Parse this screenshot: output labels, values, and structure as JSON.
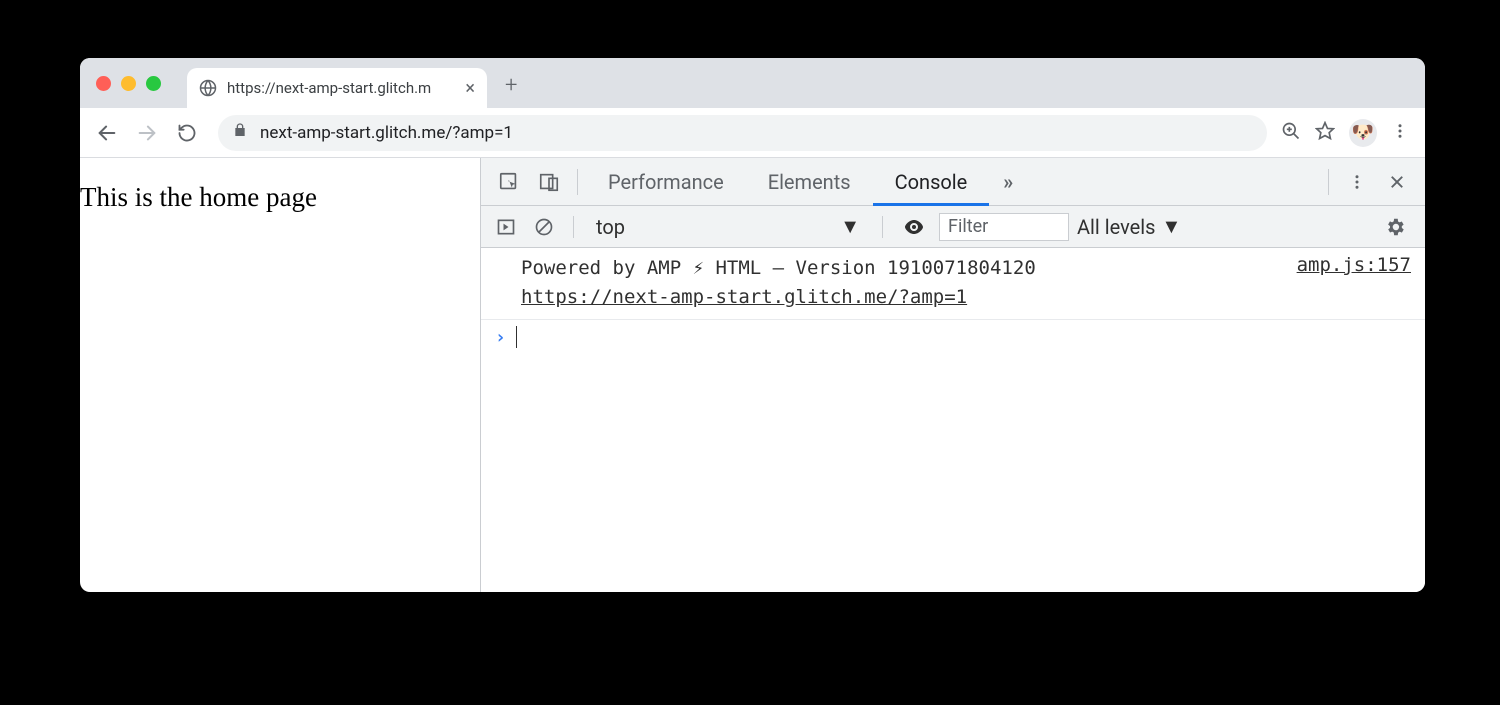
{
  "browser": {
    "tab_title": "https://next-amp-start.glitch.m",
    "new_tab_glyph": "+",
    "close_glyph": "×"
  },
  "toolbar": {
    "url": "next-amp-start.glitch.me/?amp=1"
  },
  "page": {
    "body_text": "This is the home page"
  },
  "devtools": {
    "tabs": {
      "performance": "Performance",
      "elements": "Elements",
      "console": "Console"
    },
    "overflow_glyph": "»",
    "console_bar": {
      "context": "top",
      "filter_placeholder": "Filter",
      "levels_label": "All levels"
    },
    "log": {
      "message_line1": "Powered by AMP ⚡ HTML – Version 1910071804120",
      "message_link": "https://next-amp-start.glitch.me/?amp=1",
      "source": "amp.js:157"
    },
    "prompt_glyph": "›"
  }
}
